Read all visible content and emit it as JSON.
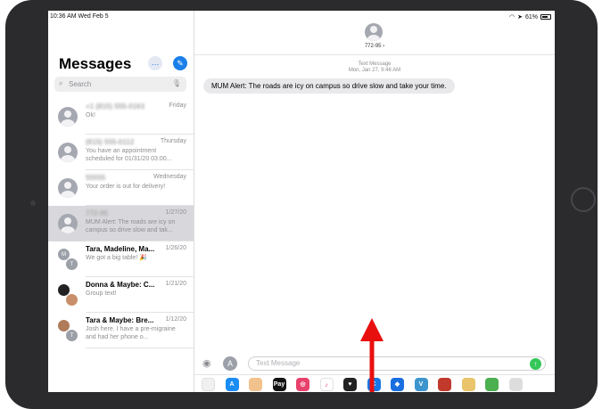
{
  "status_bar": {
    "time": "10:36 AM  Wed Feb 5",
    "battery": "61%"
  },
  "sidebar": {
    "title": "Messages",
    "more_icon": "…",
    "compose_icon": "✎",
    "search_placeholder": "Search",
    "conversations": [
      {
        "name": "+1 (815) 555-0163",
        "date": "Friday",
        "preview": "Ok!",
        "blurred": true,
        "selected": false
      },
      {
        "name": "(815) 555-0112",
        "date": "Thursday",
        "preview": "You have an appointment scheduled for 01/31/20 03:00...",
        "blurred": true,
        "selected": false
      },
      {
        "name": "55555",
        "date": "Wednesday",
        "preview": "Your order is out for delivery!",
        "blurred": true,
        "selected": false
      },
      {
        "name": "772-95",
        "date": "1/27/20",
        "preview": "MUM Alert: The roads are icy on campus so drive slow and tak...",
        "blurred": true,
        "selected": true
      },
      {
        "name": "Tara, Madeline, Ma...",
        "date": "1/26/20",
        "preview": "We got a big table! 🎉",
        "blurred": false,
        "selected": false,
        "initials": [
          "M",
          "T"
        ]
      },
      {
        "name": "Donna & Maybe: C...",
        "date": "1/21/20",
        "preview": "Group text!",
        "blurred": false,
        "selected": false,
        "initials": [
          "",
          ""
        ]
      },
      {
        "name": "Tara & Maybe: Bre...",
        "date": "1/12/20",
        "preview": "Josh here. I have a pre-migraine and had her phone o...",
        "blurred": false,
        "selected": false,
        "initials": [
          "",
          "T"
        ]
      }
    ]
  },
  "thread": {
    "contact_name": "772-95 ›",
    "meta_line1": "Text Message",
    "meta_line2": "Mon, Jan 27, 9:46 AM",
    "message": "MUM Alert: The roads are icy on campus so drive slow and take your time."
  },
  "composer": {
    "placeholder": "Text Message",
    "camera_icon": "◉",
    "appstore_icon": "A",
    "send_icon": "↑"
  },
  "app_bar": [
    {
      "name": "photos-app-icon",
      "label": "",
      "color": "#f0f0f0"
    },
    {
      "name": "app-store-app-icon",
      "label": "A",
      "color": "#1a8cf5"
    },
    {
      "name": "memoji-app-icon",
      "label": "",
      "color": "#f2c28c"
    },
    {
      "name": "apple-pay-app-icon",
      "label": "Pay",
      "color": "#111111"
    },
    {
      "name": "search-images-app-icon",
      "label": "◎",
      "color": "#e8416c"
    },
    {
      "name": "music-app-icon",
      "label": "♪",
      "color": "#ffffff"
    },
    {
      "name": "digital-touch-app-icon",
      "label": "♥",
      "color": "#222222"
    },
    {
      "name": "c-app-icon",
      "label": "C",
      "color": "#1678e8"
    },
    {
      "name": "dropbox-app-icon",
      "label": "◆",
      "color": "#1a6fe0"
    },
    {
      "name": "venmo-app-icon",
      "label": "V",
      "color": "#3d95ce"
    },
    {
      "name": "gallery-app-icon",
      "label": "",
      "color": "#c0392b"
    },
    {
      "name": "stickers-app-icon",
      "label": "",
      "color": "#e9c46a"
    },
    {
      "name": "maps-app-icon",
      "label": "",
      "color": "#4caf50"
    },
    {
      "name": "more-apps-icon",
      "label": "",
      "color": "#dddddd"
    }
  ],
  "annotation": {
    "arrow_color": "#e8100f"
  }
}
